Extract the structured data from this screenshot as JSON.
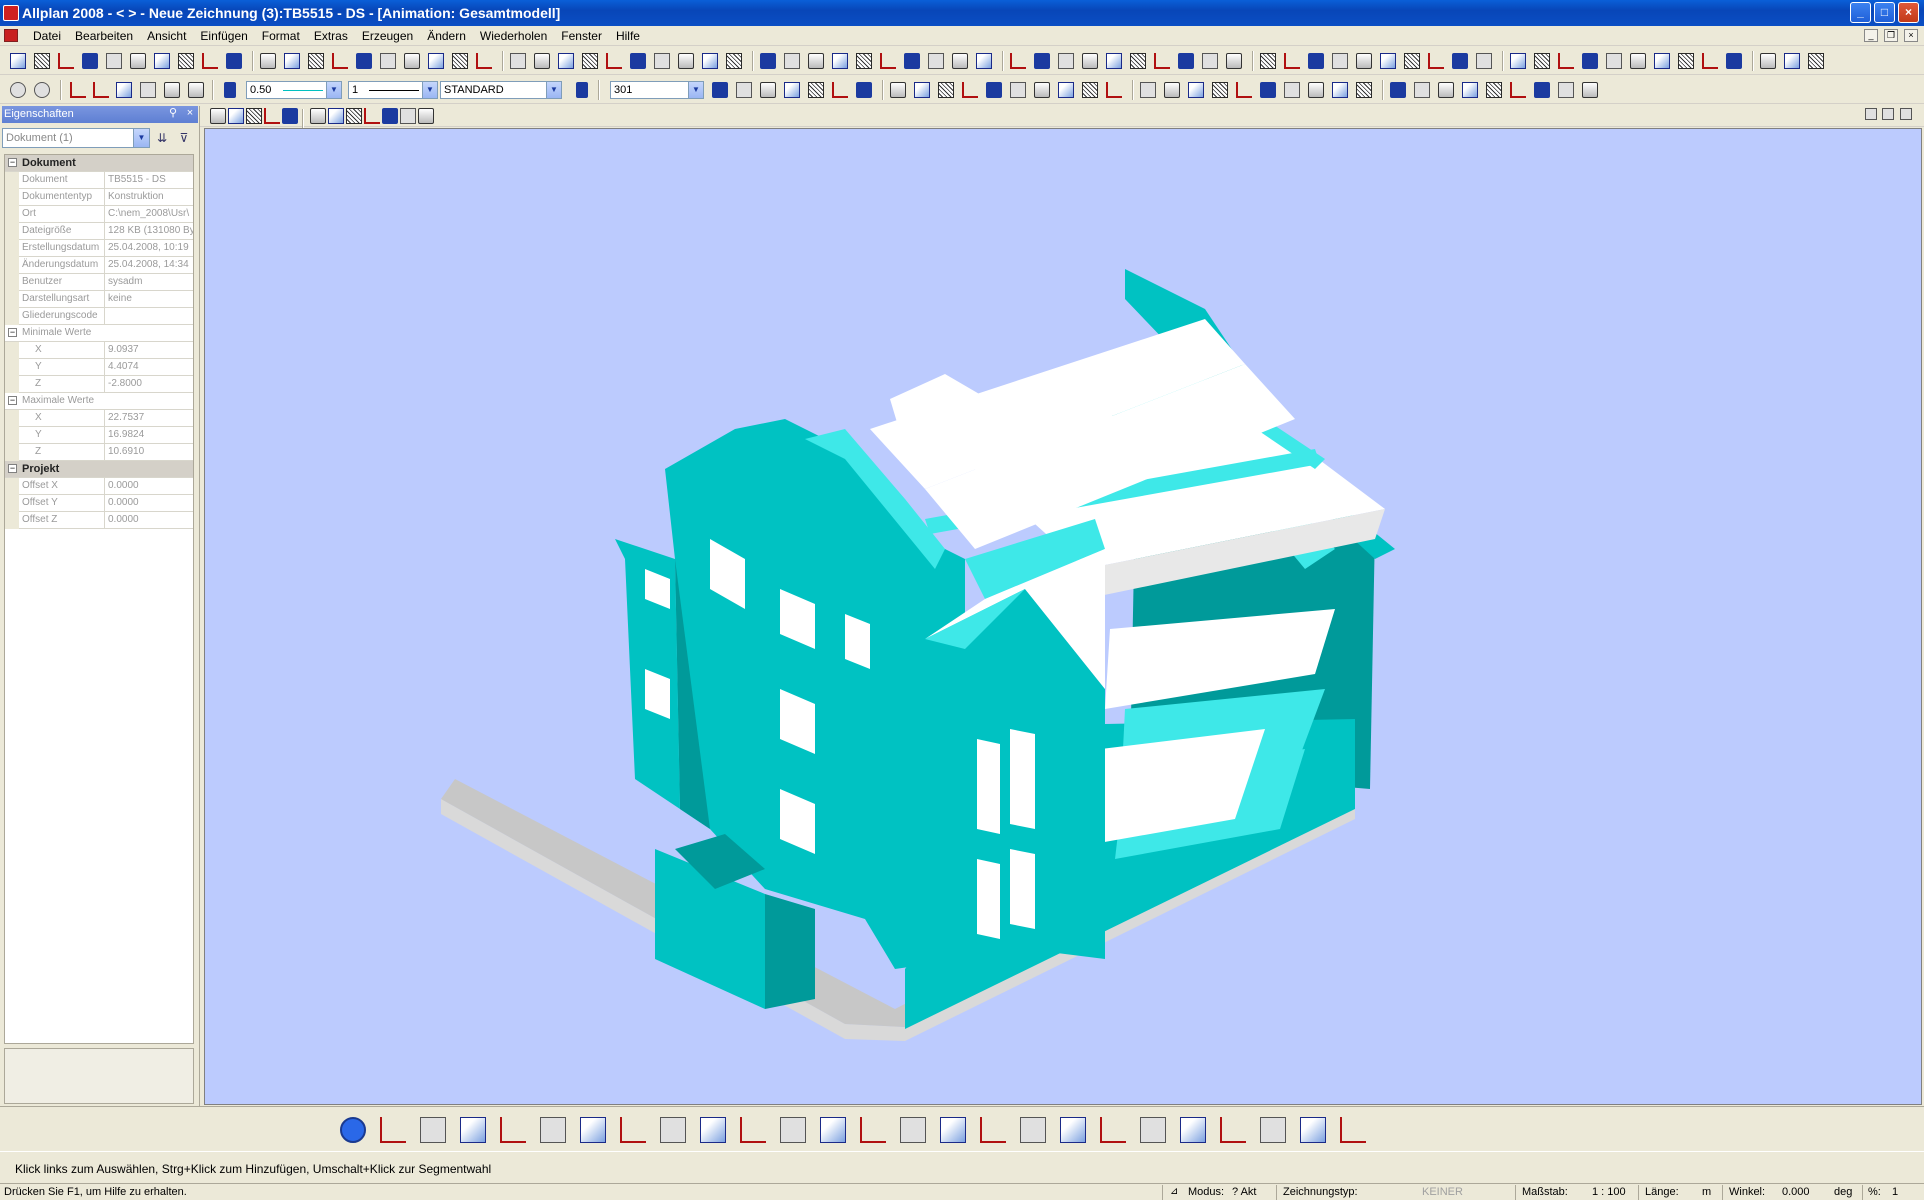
{
  "window": {
    "title": "Allplan 2008 - <      > - Neue Zeichnung (3):TB5515 - DS - [Animation: Gesamtmodell]",
    "buttons": {
      "minimize": "_",
      "maximize": "□",
      "close": "×"
    }
  },
  "menu": {
    "items": [
      "Datei",
      "Bearbeiten",
      "Ansicht",
      "Einfügen",
      "Format",
      "Extras",
      "Erzeugen",
      "Ändern",
      "Wiederholen",
      "Fenster",
      "Hilfe"
    ]
  },
  "toolbar2": {
    "pen_thickness": "0.50",
    "line_type": "1",
    "layer": "STANDARD",
    "hatch": "301"
  },
  "panel": {
    "title": "Eigenschaften",
    "selector": "Dokument (1)",
    "groups": [
      {
        "name": "Dokument",
        "rows": [
          {
            "key": "Dokument",
            "value": "TB5515 - DS"
          },
          {
            "key": "Dokumententyp",
            "value": "Konstruktion"
          },
          {
            "key": "Ort",
            "value": "C:\\nem_2008\\Usr\\"
          },
          {
            "key": "Dateigröße",
            "value": "128 KB (131080 By"
          },
          {
            "key": "Erstellungsdatum",
            "value": "25.04.2008, 10:19"
          },
          {
            "key": "Änderungsdatum",
            "value": "25.04.2008, 14:34"
          },
          {
            "key": "Benutzer",
            "value": "sysadm"
          },
          {
            "key": "Darstellungsart",
            "value": "keine"
          },
          {
            "key": "Gliederungscode",
            "value": ""
          }
        ]
      },
      {
        "name": "Minimale Werte",
        "sub": true,
        "rows": [
          {
            "key": "X",
            "value": "9.0937"
          },
          {
            "key": "Y",
            "value": "4.4074"
          },
          {
            "key": "Z",
            "value": "-2.8000"
          }
        ]
      },
      {
        "name": "Maximale Werte",
        "sub": true,
        "rows": [
          {
            "key": "X",
            "value": "22.7537"
          },
          {
            "key": "Y",
            "value": "16.9824"
          },
          {
            "key": "Z",
            "value": "10.6910"
          }
        ]
      },
      {
        "name": "Projekt",
        "rows": [
          {
            "key": "Offset X",
            "value": "0.0000"
          },
          {
            "key": "Offset Y",
            "value": "0.0000"
          },
          {
            "key": "Offset Z",
            "value": "0.0000"
          }
        ]
      }
    ]
  },
  "viewport": {
    "background": "#bccbfe",
    "model_color": "#00c2c2",
    "model_light": "#3ee8e8",
    "model_dark": "#009a9a"
  },
  "prompt": {
    "message": "Klick links zum Auswählen, Strg+Klick zum Hinzufügen, Umschalt+Klick zur Segmentwahl"
  },
  "status": {
    "help": "Drücken Sie F1, um Hilfe zu erhalten.",
    "modus_label": "Modus:",
    "modus_value": "? Akt",
    "zeichnungstyp_label": "Zeichnungstyp:",
    "zeichnungstyp_value": "KEINER",
    "massstab_label": "Maßstab:",
    "massstab_value": "1 : 100",
    "laenge_label": "Länge:",
    "laenge_value": "m",
    "winkel_label": "Winkel:",
    "winkel_value": "0.000",
    "winkel_unit": "deg",
    "percent_label": "%:",
    "percent_value": "1"
  }
}
